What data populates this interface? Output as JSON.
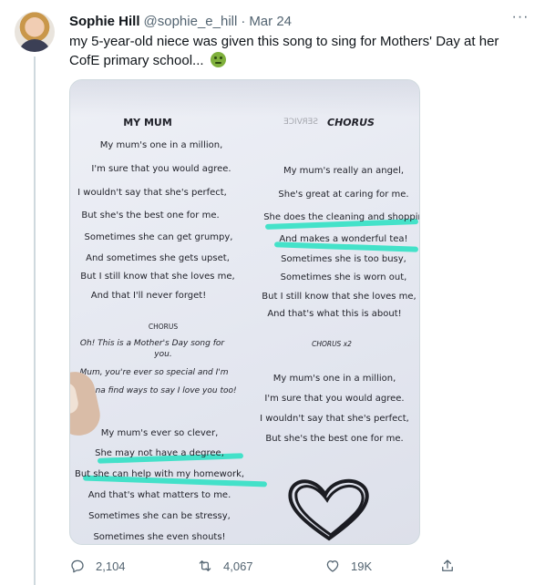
{
  "tweet": {
    "name": "Sophie Hill",
    "handle": "@sophie_e_hill",
    "separator": "·",
    "date": "Mar 24",
    "more": "···",
    "text": "my 5-year-old niece was given this song to sing for Mothers' Day at her CofE primary school...",
    "emoji": "nauseated-face-icon"
  },
  "photo": {
    "left_title": "MY MUM",
    "left_verse": [
      "My mum's one in a million,",
      "I'm sure that you would agree.",
      "I wouldn't say that she's perfect,",
      "But she's the best one for me.",
      "Sometimes she can get grumpy,",
      "And sometimes she gets upset,",
      "But I still know that she loves me,",
      "And that I'll never forget!"
    ],
    "left_chorus_label": "CHORUS",
    "left_chorus": [
      "Oh! This is a Mother's Day song for",
      "you.",
      "Mum, you're ever so special and I'm",
      "Gonna find ways to say I love you too!"
    ],
    "left_verse2": [
      "My mum's ever so clever,",
      "She may not have a degree,",
      "But she can help with my homework,",
      "And that's what matters to me.",
      "Sometimes she can be stressy,",
      "Sometimes she even shouts!"
    ],
    "right_title": "CHORUS",
    "right_bleed_title": "SERVICE",
    "right_verse": [
      "My mum's really an angel,",
      "She's great at caring for me.",
      "She does the cleaning and shoppin",
      "And makes a wonderful tea!",
      "Sometimes she is too busy,",
      "Sometimes she is worn out,",
      "But I still know that she loves me,",
      "And that's what this is about!"
    ],
    "right_chorus_x2": "CHORUS x2",
    "right_verse2": [
      "My mum's one in a million,",
      "I'm sure that you would agree.",
      "I wouldn't say that she's perfect,",
      "But she's the best one for me."
    ],
    "highlight_color": "#27e0c2"
  },
  "actions": {
    "replies": "2,104",
    "retweets": "4,067",
    "likes": "19K"
  }
}
